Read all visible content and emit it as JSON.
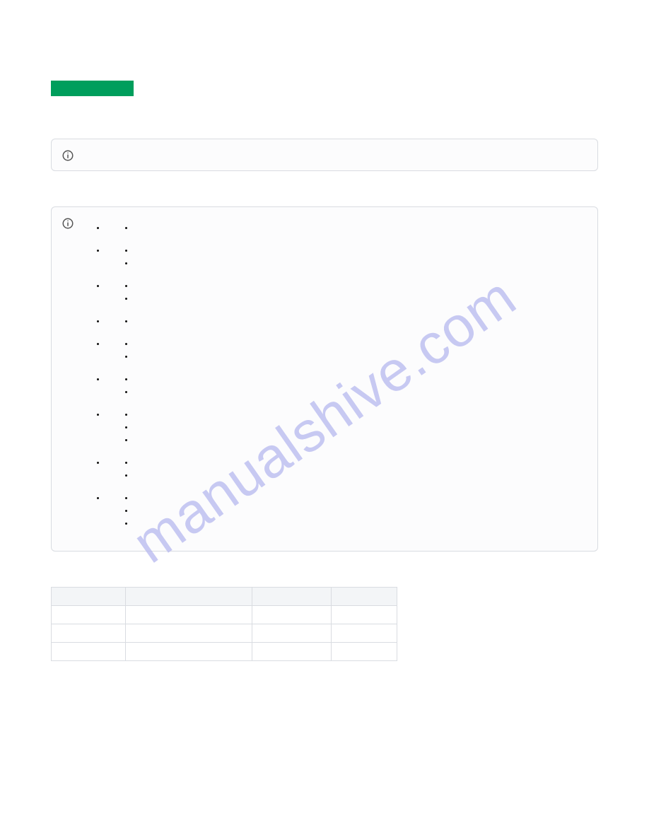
{
  "watermark": "manualshive.com",
  "green_bar_label": "",
  "info_box_1_text": "",
  "list": {
    "items": [
      {
        "label": "",
        "sub": [
          ""
        ]
      },
      {
        "label": "",
        "sub": [
          "",
          ""
        ]
      },
      {
        "label": "",
        "sub": [
          "",
          ""
        ]
      },
      {
        "label": "",
        "sub": [
          ""
        ]
      },
      {
        "label": "",
        "sub": [
          "",
          ""
        ]
      },
      {
        "label": "",
        "sub": [
          "",
          ""
        ]
      },
      {
        "label": "",
        "sub": [
          "",
          "",
          ""
        ]
      },
      {
        "label": "",
        "sub": [
          "",
          ""
        ]
      },
      {
        "label": "",
        "sub": [
          "",
          "",
          ""
        ]
      }
    ]
  },
  "table": {
    "headers": [
      "",
      "",
      "",
      ""
    ],
    "rows": [
      [
        "",
        "",
        "",
        ""
      ],
      [
        "",
        "",
        "",
        ""
      ],
      [
        "",
        "",
        "",
        ""
      ]
    ]
  }
}
